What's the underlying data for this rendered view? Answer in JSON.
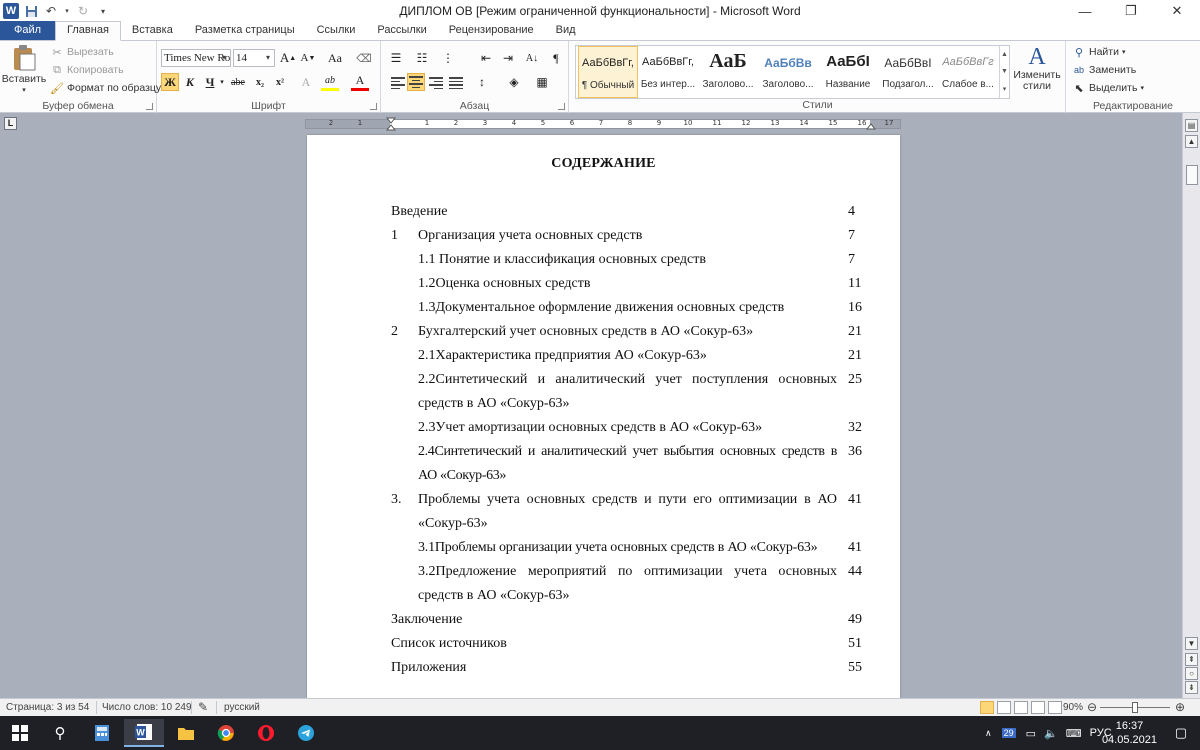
{
  "window": {
    "title": "ДИПЛОМ  ОВ [Режим ограниченной функциональности]  -  Microsoft Word",
    "app_logo": "W",
    "quick_access": [
      "save-icon",
      "undo-icon",
      "redo-icon",
      "customize-icon"
    ]
  },
  "ribbon_tabs": [
    "Файл",
    "Главная",
    "Вставка",
    "Разметка страницы",
    "Ссылки",
    "Рассылки",
    "Рецензирование",
    "Вид"
  ],
  "clipboard": {
    "paste_label": "Вставить",
    "cut_label": "Вырезать",
    "copy_label": "Копировать",
    "format_painter_label": "Формат по образцу",
    "group_label": "Буфер обмена"
  },
  "font": {
    "family": "Times New Roman",
    "family_display": "Times New Ro",
    "size": "14",
    "grow_label": "A",
    "shrink_label": "A",
    "case_label": "Aa",
    "bold_label": "Ж",
    "italic_label": "К",
    "underline_label": "Ч",
    "strike_label": "abe",
    "subscript_label": "x₂",
    "superscript_label": "x²",
    "effects_label": "A",
    "highlight_label": "ab",
    "color_label": "A",
    "group_label": "Шрифт"
  },
  "paragraph": {
    "group_label": "Абзац",
    "show_marks_label": "¶"
  },
  "styles": {
    "group_label": "Стили",
    "items": [
      {
        "sample": "АаБбВвГг,",
        "name": "¶ Обычный"
      },
      {
        "sample": "АаБбВвГг,",
        "name": "Без интер..."
      },
      {
        "sample": "АаБ",
        "name": "Заголово..."
      },
      {
        "sample": "АаБбВв",
        "name": "Заголово..."
      },
      {
        "sample": "АаБбІ",
        "name": "Название"
      },
      {
        "sample": "АаБбВвІ",
        "name": "Подзагол..."
      },
      {
        "sample": "АаБбВвГг",
        "name": "Слабое в..."
      }
    ],
    "change_styles_label": "Изменить стили"
  },
  "editing": {
    "group_label": "Редактирование",
    "find_label": "Найти",
    "replace_label": "Заменить",
    "select_label": "Выделить"
  },
  "ruler": {
    "corner_label": "L",
    "numbers": [
      "2",
      "1",
      "1",
      "2",
      "3",
      "4",
      "5",
      "6",
      "7",
      "8",
      "9",
      "10",
      "11",
      "12",
      "13",
      "14",
      "15",
      "16",
      "17"
    ]
  },
  "document": {
    "heading": "СОДЕРЖАНИЕ",
    "toc": [
      {
        "num": "",
        "text": "Введение",
        "page": "4"
      },
      {
        "num": "1",
        "text": "Организация учета основных средств",
        "page": "7"
      },
      {
        "num": "",
        "text": "1.1 Понятие и классификация основных средств",
        "page": "7"
      },
      {
        "num": "",
        "text": "1.2Оценка основных средств",
        "page": "11"
      },
      {
        "num": "",
        "text": "1.3Документальное оформление движения основных средств",
        "page": "16"
      },
      {
        "num": "2",
        "text": "Бухгалтерский учет основных средств  в АО «Сокур-63»",
        "page": "21"
      },
      {
        "num": "",
        "text": "2.1Характеристика предприятия АО «Сокур-63»",
        "page": "21"
      },
      {
        "num": "",
        "text": "2.2Синтетический и аналитический учет поступления основных средств в АО «Сокур-63»",
        "page": "25"
      },
      {
        "num": "",
        "text": "2.3Учет амортизации основных средств в АО «Сокур-63»",
        "page": "32"
      },
      {
        "num": "",
        "text": "2.4Синтетический и аналитический учет выбытия основных средств в АО «Сокур-63»",
        "page": "36"
      },
      {
        "num": "3.",
        "text": "Проблемы учета основных средств и пути его оптимизации в АО «Сокур-63»",
        "page": "41"
      },
      {
        "num": "",
        "text": "3.1Проблемы организации учета основных средств в АО «Сокур-63»",
        "page": "41"
      },
      {
        "num": "",
        "text": "3.2Предложение мероприятий по оптимизации учета основных средств в АО «Сокур-63»",
        "page": "44"
      },
      {
        "num": "",
        "text": "Заключение",
        "page": "49"
      },
      {
        "num": "",
        "text": "Список источников",
        "page": "51"
      },
      {
        "num": "",
        "text": "Приложения",
        "page": "55"
      }
    ]
  },
  "statusbar": {
    "page": "Страница: 3 из 54",
    "words": "Число слов: 10 249",
    "language": "русский",
    "zoom": "90%",
    "zoom_level": 90
  },
  "taskbar": {
    "time": "16:37",
    "date": "04.05.2021",
    "lang": "РУС",
    "badge": "29"
  }
}
